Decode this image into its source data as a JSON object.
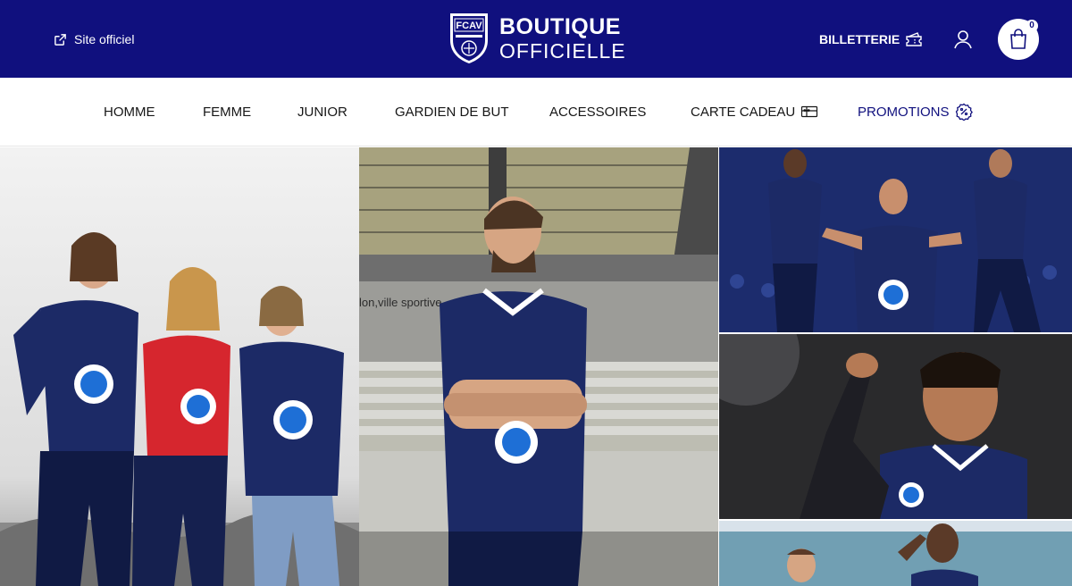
{
  "header": {
    "site_link": "Site officiel",
    "crest_text": "FCAV",
    "brand_line1": "BOUTIQUE",
    "brand_line2": "OFFICIELLE",
    "billetterie": "BILLETTERIE",
    "cart_count": "0"
  },
  "nav": {
    "items": [
      "HOMME",
      "FEMME",
      "JUNIOR",
      "GARDIEN DE BUT",
      "ACCESSOIRES",
      "CARTE CADEAU",
      "PROMOTIONS"
    ]
  },
  "hero": {
    "mid_wall_text": "lon,ville sportive"
  },
  "colors": {
    "brand_navy": "#10107e",
    "jersey_navy": "#1c2a66",
    "jersey_red": "#d6262e",
    "white": "#ffffff"
  },
  "icons": [
    "external-link-icon",
    "ticket-icon",
    "user-icon",
    "shopping-bag-icon",
    "gift-card-icon",
    "discount-badge-icon"
  ]
}
